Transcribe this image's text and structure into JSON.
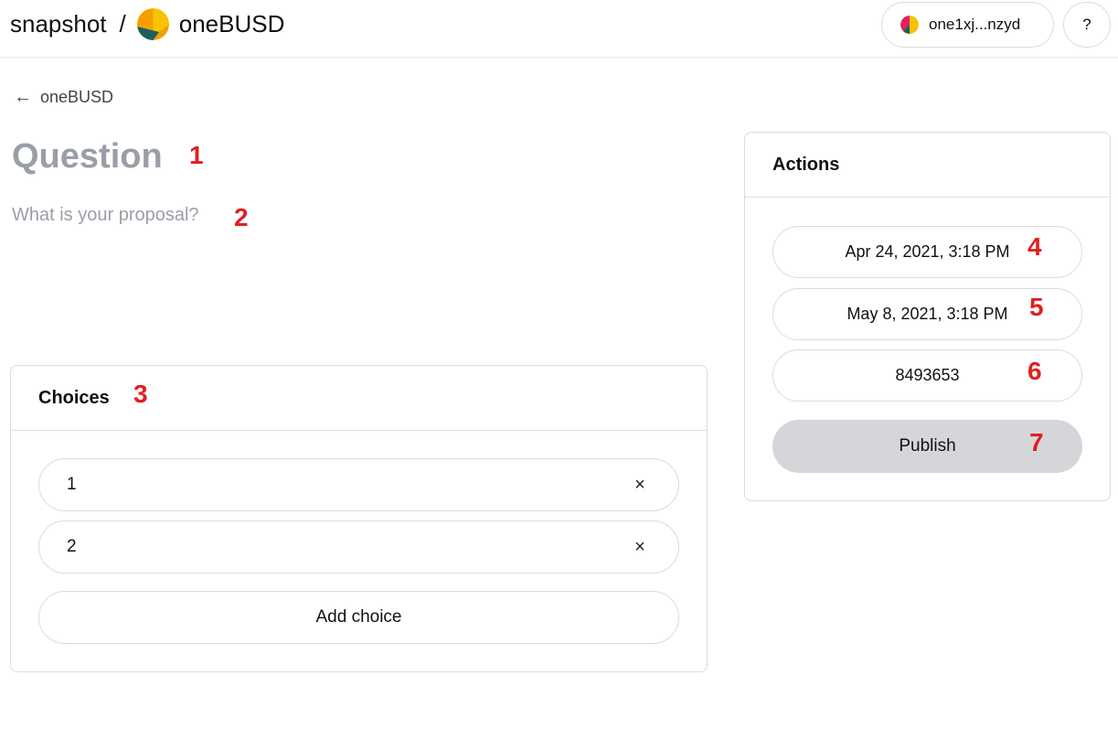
{
  "header": {
    "app_name": "snapshot",
    "separator": "/",
    "space_name": "oneBUSD",
    "wallet_label": "one1xj...nzyd",
    "help_label": "?"
  },
  "back_link": {
    "arrow": "←",
    "label": "oneBUSD"
  },
  "question": {
    "placeholder": "Question",
    "value": ""
  },
  "proposal": {
    "placeholder": "What is your proposal?",
    "value": ""
  },
  "choices": {
    "title": "Choices",
    "items": [
      {
        "value": "1",
        "remove_icon": "close-icon"
      },
      {
        "value": "2",
        "remove_icon": "close-icon"
      }
    ],
    "remove_symbol": "×",
    "add_label": "Add choice"
  },
  "actions": {
    "title": "Actions",
    "start_date": "Apr 24, 2021, 3:18 PM",
    "end_date": "May 8, 2021, 3:18 PM",
    "snapshot_block": "8493653",
    "publish_label": "Publish"
  },
  "annotations": [
    "1",
    "2",
    "3",
    "4",
    "5",
    "6",
    "7"
  ],
  "colors": {
    "annotation": "#e02020",
    "placeholder": "#9a9ea6",
    "border": "#dcdcdc",
    "publish_bg": "#d4d6da",
    "avatar_orange": "#f4a000",
    "avatar_teal": "#1d5f5f",
    "avatar_yellow": "#f7c300"
  }
}
